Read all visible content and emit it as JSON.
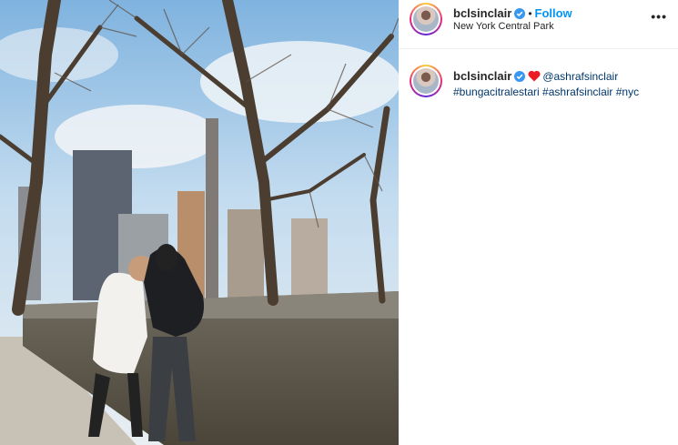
{
  "post": {
    "username": "bclsinclair",
    "follow_label": "Follow",
    "separator": "•",
    "location": "New York Central Park",
    "more_label": "•••",
    "photo_alt": "Couple kissing by a stone wall in Central Park under bare winter trees"
  },
  "caption": {
    "username": "bclsinclair",
    "mention": "@ashrafsinclair",
    "hashtags": "#bungacitralestari #ashrafsinclair #nyc"
  },
  "colors": {
    "accent": "#0095f6",
    "verified": "#3897f0",
    "heart": "#ed1c24",
    "link": "#00376b"
  },
  "icons": {
    "verified": "verified-badge-icon",
    "heart": "red-heart-icon",
    "more": "more-options-icon"
  }
}
